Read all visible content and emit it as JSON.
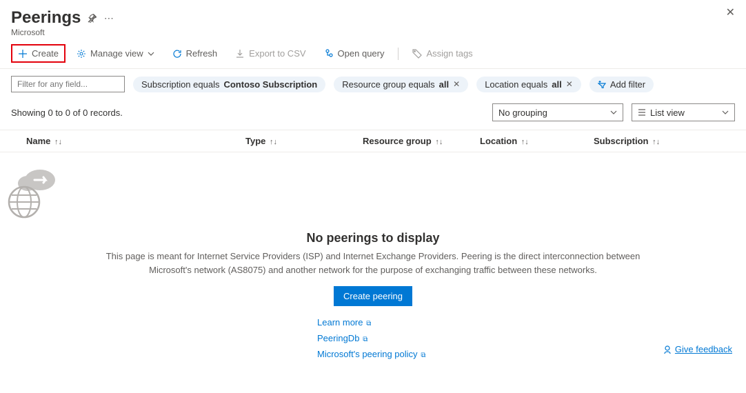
{
  "header": {
    "title": "Peerings",
    "subtitle": "Microsoft"
  },
  "toolbar": {
    "create": "Create",
    "manage_view": "Manage view",
    "refresh": "Refresh",
    "export_csv": "Export to CSV",
    "open_query": "Open query",
    "assign_tags": "Assign tags"
  },
  "filters": {
    "placeholder": "Filter for any field...",
    "subscription": {
      "label": "Subscription equals ",
      "value": "Contoso Subscription"
    },
    "resource_group": {
      "label": "Resource group equals ",
      "value": "all"
    },
    "location": {
      "label": "Location equals ",
      "value": "all"
    },
    "add": "Add filter"
  },
  "status": {
    "count_text": "Showing 0 to 0 of 0 records.",
    "grouping": "No grouping",
    "view_mode": "List view"
  },
  "columns": {
    "name": "Name",
    "type": "Type",
    "resource_group": "Resource group",
    "location": "Location",
    "subscription": "Subscription"
  },
  "empty": {
    "title": "No peerings to display",
    "description": "This page is meant for Internet Service Providers (ISP) and Internet Exchange Providers. Peering is the direct interconnection between Microsoft's network (AS8075) and another network for the purpose of exchanging traffic between these networks.",
    "button": "Create peering",
    "links": {
      "learn_more": "Learn more",
      "peeringdb": "PeeringDb",
      "policy": "Microsoft's peering policy"
    }
  },
  "feedback": "Give feedback"
}
